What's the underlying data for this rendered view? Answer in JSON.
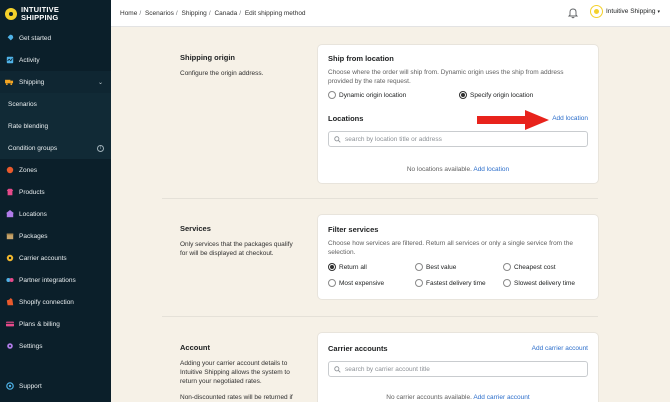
{
  "brand": {
    "line1": "INTUITIVE",
    "line2": "SHIPPING"
  },
  "sidebar": {
    "items": [
      {
        "label": "Get started",
        "icon": "rocket-icon"
      },
      {
        "label": "Activity",
        "icon": "activity-icon"
      },
      {
        "label": "Shipping",
        "icon": "shipping-icon"
      },
      {
        "label": "Scenarios"
      },
      {
        "label": "Rate blending"
      },
      {
        "label": "Condition groups"
      },
      {
        "label": "Zones",
        "icon": "zones-icon"
      },
      {
        "label": "Products",
        "icon": "products-icon"
      },
      {
        "label": "Locations",
        "icon": "locations-icon"
      },
      {
        "label": "Packages",
        "icon": "packages-icon"
      },
      {
        "label": "Carrier accounts",
        "icon": "carrier-icon"
      },
      {
        "label": "Partner integrations",
        "icon": "partner-icon"
      },
      {
        "label": "Shopify connection",
        "icon": "shopify-icon"
      },
      {
        "label": "Plans & billing",
        "icon": "billing-icon"
      },
      {
        "label": "Settings",
        "icon": "settings-icon"
      }
    ],
    "support": "Support"
  },
  "breadcrumb": [
    "Home",
    "Scenarios",
    "Shipping",
    "Canada",
    "Edit shipping method"
  ],
  "account": {
    "name": "Intuitive Shipping"
  },
  "sections": {
    "origin": {
      "title": "Shipping origin",
      "desc": "Configure the origin address.",
      "card_title": "Ship from location",
      "card_text": "Choose where the order will ship from. Dynamic origin uses the ship from address provided by the rate request.",
      "opt_dynamic": "Dynamic origin location",
      "opt_specify": "Specify origin location",
      "locations_title": "Locations",
      "add_location": "Add location",
      "search_placeholder": "search by location title or address",
      "empty_text": "No locations available.",
      "empty_link": "Add location"
    },
    "services": {
      "title": "Services",
      "desc": "Only services that the packages qualify for will be displayed at checkout.",
      "card_title": "Filter services",
      "card_text": "Choose how services are filtered. Return all services or only a single service from the selection.",
      "options": [
        "Return all",
        "Best value",
        "Cheapest cost",
        "Most expensive",
        "Fastest delivery time",
        "Slowest delivery time"
      ]
    },
    "account": {
      "title": "Account",
      "desc1": "Adding your carrier account details to Intuitive Shipping allows the system to return your negotiated rates.",
      "desc2": "Non-discounted rates will be returned if",
      "card_title": "Carrier accounts",
      "add_link": "Add carrier account",
      "search_placeholder": "search by carrier account title",
      "empty_text": "No carrier accounts available.",
      "empty_link": "Add carrier account"
    }
  },
  "colors": {
    "sidebar": "#0b1f2a",
    "accent": "#f4d12b",
    "link": "#2c6ecb",
    "arrow": "#e8231c",
    "background": "#f6f1e7"
  }
}
